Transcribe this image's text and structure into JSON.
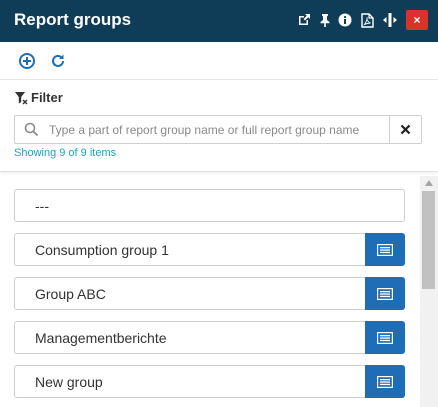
{
  "window": {
    "title": "Report groups",
    "icons": [
      "popout-icon",
      "pin-icon",
      "info-icon",
      "pdf-icon",
      "resize-icon",
      "close-icon"
    ],
    "close_label": "×",
    "accent_color": "#0f3d57",
    "close_color": "#d9322a"
  },
  "toolbar": {
    "add_icon": "plus-circle-icon",
    "refresh_icon": "refresh-icon"
  },
  "filter": {
    "label": "Filter",
    "search_placeholder": "Type a part of report group name or full report group name",
    "search_value": "",
    "clear_label": "✕",
    "showing_text": "Showing 9 of 9 items",
    "link_color": "#1aa3c9"
  },
  "groups": [
    {
      "label": "---"
    },
    {
      "label": "Consumption group 1"
    },
    {
      "label": "Group ABC"
    },
    {
      "label": "Managementberichte"
    },
    {
      "label": "New group"
    }
  ],
  "button_color": "#1e6db5"
}
